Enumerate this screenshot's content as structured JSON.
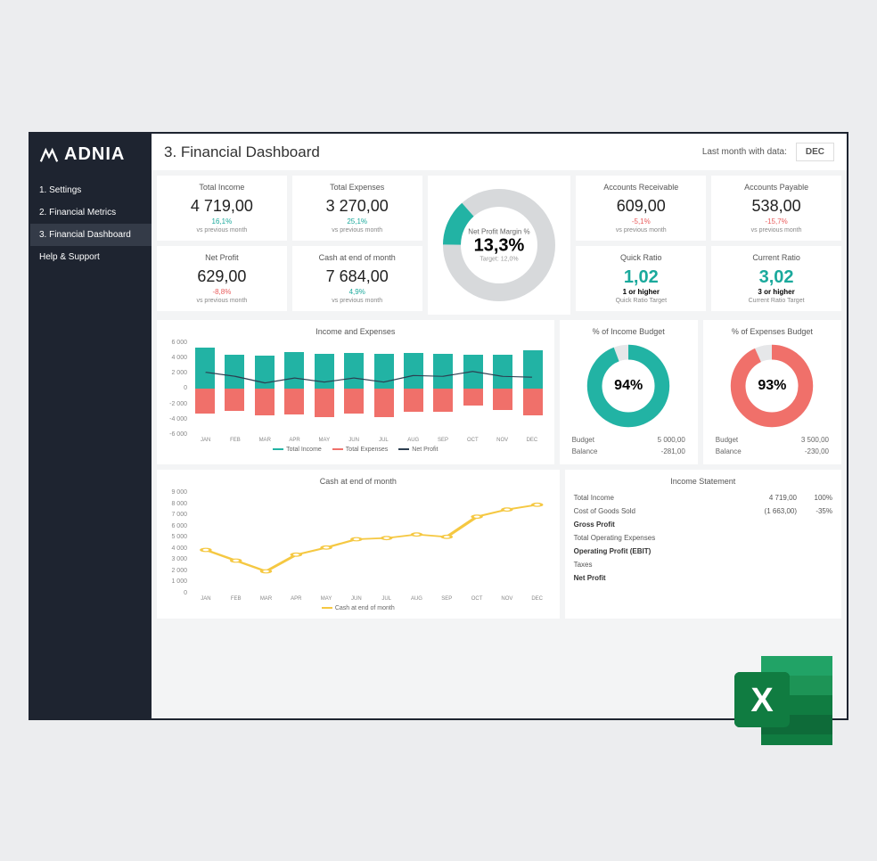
{
  "brand": "ADNIA",
  "nav": {
    "items": [
      "1. Settings",
      "2. Financial Metrics",
      "3. Financial Dashboard",
      "Help & Support"
    ]
  },
  "header": {
    "title": "3. Financial Dashboard",
    "last_month_label": "Last month with data:",
    "month": "DEC"
  },
  "kpi": {
    "total_income": {
      "title": "Total Income",
      "value": "4 719,00",
      "change": "16,1%",
      "change_dir": "pos",
      "sub": "vs previous month"
    },
    "total_expenses": {
      "title": "Total Expenses",
      "value": "3 270,00",
      "change": "25,1%",
      "change_dir": "pos",
      "sub": "vs previous month"
    },
    "accounts_receivable": {
      "title": "Accounts Receivable",
      "value": "609,00",
      "change": "-5,1%",
      "change_dir": "neg",
      "sub": "vs previous month"
    },
    "accounts_payable": {
      "title": "Accounts Payable",
      "value": "538,00",
      "change": "-15,7%",
      "change_dir": "neg",
      "sub": "vs previous month"
    },
    "net_profit": {
      "title": "Net Profit",
      "value": "629,00",
      "change": "-8,8%",
      "change_dir": "neg",
      "sub": "vs previous month"
    },
    "cash_eom": {
      "title": "Cash at end of month",
      "value": "7 684,00",
      "change": "4,9%",
      "change_dir": "pos",
      "sub": "vs previous month"
    },
    "npm": {
      "title": "Net Profit Margin %",
      "value": "13,3%",
      "target": "Target: 12,0%"
    },
    "quick_ratio": {
      "title": "Quick Ratio",
      "value": "1,02",
      "target": "1 or higher",
      "sub": "Quick Ratio Target"
    },
    "current_ratio": {
      "title": "Current Ratio",
      "value": "3,02",
      "target": "3 or higher",
      "sub": "Current Ratio Target"
    }
  },
  "budget": {
    "income": {
      "title": "% of Income Budget",
      "pct": "94%",
      "budget_label": "Budget",
      "budget_val": "5 000,00",
      "balance_label": "Balance",
      "balance_val": "-281,00"
    },
    "expenses": {
      "title": "% of Expenses Budget",
      "pct": "93%",
      "budget_label": "Budget",
      "budget_val": "3 500,00",
      "balance_label": "Balance",
      "balance_val": "-230,00"
    }
  },
  "statement": {
    "title": "Income Statement",
    "rows": [
      {
        "label": "Total Income",
        "amt": "4 719,00",
        "pct": "100%",
        "bold": false
      },
      {
        "label": "Cost of Goods Sold",
        "amt": "(1 663,00)",
        "pct": "-35%",
        "bold": false
      },
      {
        "label": "Gross Profit",
        "amt": "",
        "pct": "",
        "bold": true
      },
      {
        "label": "Total Operating Expenses",
        "amt": "",
        "pct": "",
        "bold": false
      },
      {
        "label": "Operating Profit (EBIT)",
        "amt": "",
        "pct": "",
        "bold": true
      },
      {
        "label": "Taxes",
        "amt": "",
        "pct": "",
        "bold": false
      },
      {
        "label": "Net Profit",
        "amt": "",
        "pct": "",
        "bold": true
      }
    ]
  },
  "chart_data": [
    {
      "type": "bar",
      "title": "Income and Expenses",
      "categories": [
        "JAN",
        "FEB",
        "MAR",
        "APR",
        "MAY",
        "JUN",
        "JUL",
        "AUG",
        "SEP",
        "OCT",
        "NOV",
        "DEC"
      ],
      "series": [
        {
          "name": "Total Income",
          "values": [
            5000,
            4200,
            4000,
            4500,
            4300,
            4400,
            4300,
            4400,
            4300,
            4200,
            4100,
            4700
          ]
        },
        {
          "name": "Total Expenses",
          "values": [
            -3000,
            -2700,
            -3300,
            -3200,
            -3500,
            -3100,
            -3500,
            -2800,
            -2800,
            -2100,
            -2600,
            -3300
          ]
        },
        {
          "name": "Net Profit",
          "values": [
            2000,
            1500,
            700,
            1300,
            800,
            1300,
            800,
            1600,
            1500,
            2100,
            1500,
            1400
          ]
        }
      ],
      "ylim": [
        -6000,
        6000
      ],
      "yticks": [
        6000,
        4000,
        2000,
        0,
        -2000,
        -4000,
        -6000
      ]
    },
    {
      "type": "line",
      "title": "Cash at end of month",
      "categories": [
        "JAN",
        "FEB",
        "MAR",
        "APR",
        "MAY",
        "JUN",
        "JUL",
        "AUG",
        "SEP",
        "OCT",
        "NOV",
        "DEC"
      ],
      "series": [
        {
          "name": "Cash at end of month",
          "values": [
            3900,
            3000,
            2100,
            3500,
            4100,
            4800,
            4900,
            5200,
            5000,
            6700,
            7300,
            7700
          ]
        }
      ],
      "ylim": [
        0,
        9000
      ],
      "yticks": [
        9000,
        8000,
        7000,
        6000,
        5000,
        4000,
        3000,
        2000,
        1000,
        0
      ]
    }
  ],
  "colors": {
    "teal": "#22b3a4",
    "red": "#f0706a",
    "yellow": "#f5c842",
    "dark": "#2c3e50"
  }
}
